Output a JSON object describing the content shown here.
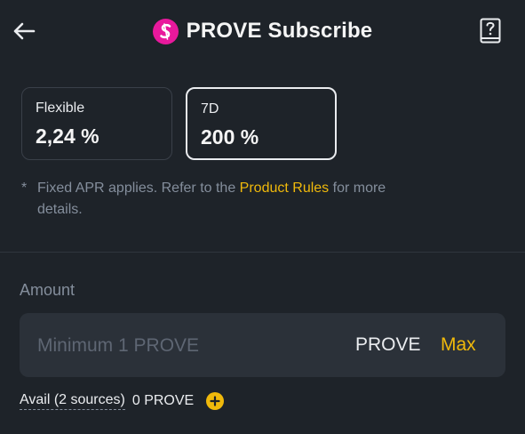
{
  "header": {
    "title": "PROVE Subscribe",
    "back_icon": "arrow-left-icon",
    "help_icon": "book-question-icon",
    "token_logo_color": "#e8199c"
  },
  "terms": [
    {
      "label": "Flexible",
      "value": "2,24 %",
      "selected": false
    },
    {
      "label": "7D",
      "value": "200 %",
      "selected": true
    }
  ],
  "note": {
    "star": "*",
    "text_before": "Fixed APR applies. Refer to the ",
    "link": "Product Rules",
    "text_after": " for more",
    "text_line2": "details."
  },
  "amount": {
    "label": "Amount",
    "placeholder": "Minimum 1 PROVE",
    "value": "",
    "unit": "PROVE",
    "max_label": "Max"
  },
  "avail": {
    "label": "Avail (2 sources)",
    "value": "0 PROVE",
    "add_icon": "plus-circle-icon"
  },
  "colors": {
    "background": "#1e2329",
    "accent": "#f0b90b",
    "input_bg": "#2b3139",
    "muted_text": "#848e9c"
  }
}
